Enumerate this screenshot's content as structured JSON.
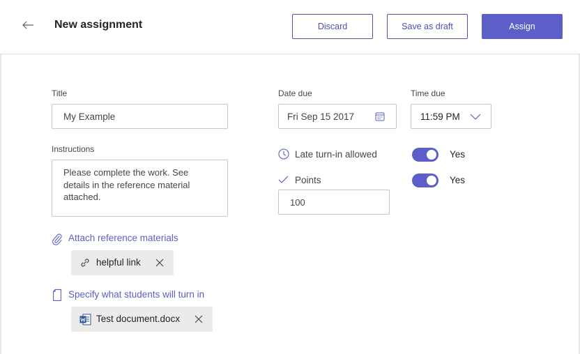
{
  "header": {
    "title": "New assignment",
    "discard_label": "Discard",
    "save_draft_label": "Save as draft",
    "assign_label": "Assign"
  },
  "form": {
    "title_label": "Title",
    "title_value": "My Example",
    "instructions_label": "Instructions",
    "instructions_value": "Please complete the work. See details in the reference material attached.",
    "date_due_label": "Date due",
    "date_due_value": "Fri Sep 15 2017",
    "time_due_label": "Time due",
    "time_due_value": "11:59 PM",
    "late_turnin_label": "Late turn-in allowed",
    "late_turnin_state": "Yes",
    "points_label": "Points",
    "points_state": "Yes",
    "points_value": "100"
  },
  "attachments": {
    "reference_link_label": "Attach reference materials",
    "reference_items": [
      {
        "label": "helpful link",
        "icon": "link-icon"
      }
    ],
    "turnin_link_label": "Specify what students will turn in",
    "turnin_items": [
      {
        "label": "Test document.docx",
        "icon": "word-doc-icon"
      }
    ]
  },
  "colors": {
    "accent": "#5b5fc7",
    "accent_text": "#4f52b2",
    "chip_bg": "#edebe9",
    "border": "#c8c6c4"
  }
}
